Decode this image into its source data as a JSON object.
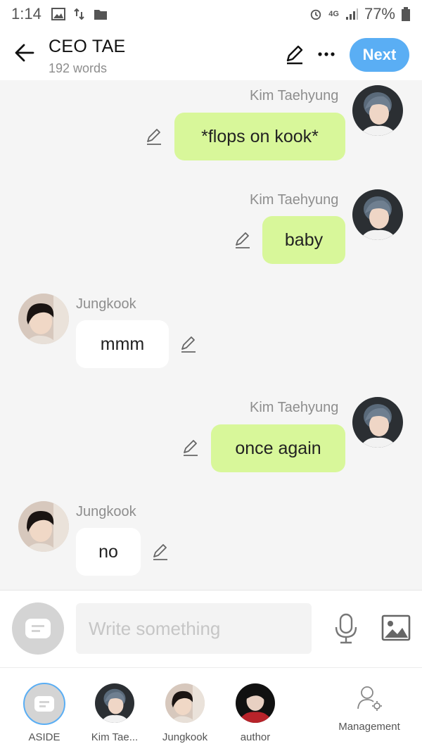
{
  "status_bar": {
    "time": "1:14",
    "network": "4G",
    "battery": "77%",
    "left_icons": [
      "image-icon",
      "sync-icon",
      "folder-icon"
    ],
    "right_icons": [
      "alarm-icon",
      "signal-icon",
      "battery-icon"
    ]
  },
  "header": {
    "title": "CEO TAE",
    "subtitle": "192 words",
    "next_label": "Next"
  },
  "messages": [
    {
      "sender": "Kim Taehyung",
      "text": "*flops on kook*",
      "side": "right",
      "bubble_color": "#d8f79a"
    },
    {
      "sender": "Kim Taehyung",
      "text": "baby",
      "side": "right",
      "bubble_color": "#d8f79a"
    },
    {
      "sender": "Jungkook",
      "text": "mmm",
      "side": "left",
      "bubble_color": "#ffffff"
    },
    {
      "sender": "Kim Taehyung",
      "text": "once again",
      "side": "right",
      "bubble_color": "#d8f79a"
    },
    {
      "sender": "Jungkook",
      "text": "no",
      "side": "left",
      "bubble_color": "#ffffff"
    }
  ],
  "composer": {
    "placeholder": "Write something"
  },
  "bottom_tabs": [
    {
      "label": "ASIDE"
    },
    {
      "label": "Kim Tae..."
    },
    {
      "label": "Jungkook"
    },
    {
      "label": "author"
    },
    {
      "label": "Management"
    }
  ],
  "colors": {
    "accent": "#5aaef4",
    "my_bubble": "#d8f79a",
    "other_bubble": "#ffffff",
    "background": "#f5f5f5"
  }
}
